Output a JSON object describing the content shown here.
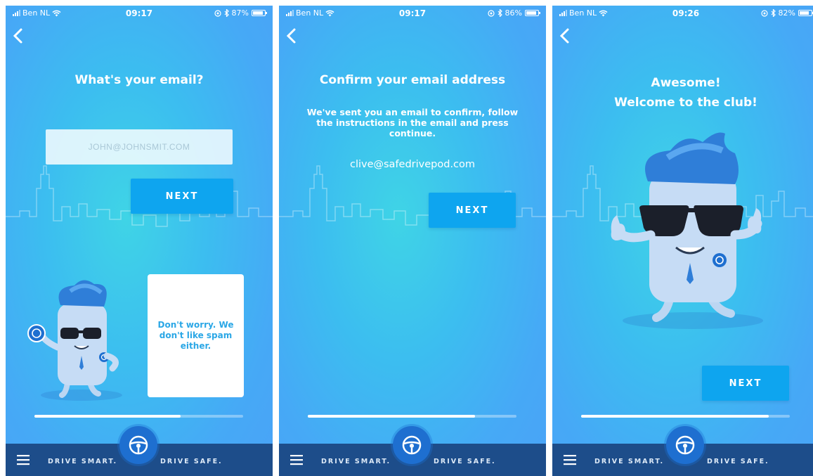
{
  "status_bar": [
    {
      "carrier": "Ben NL",
      "time": "09:17",
      "battery_text": "87%",
      "battery_level": 0.87
    },
    {
      "carrier": "Ben NL",
      "time": "09:17",
      "battery_text": "86%",
      "battery_level": 0.86
    },
    {
      "carrier": "Ben NL",
      "time": "09:26",
      "battery_text": "82%",
      "battery_level": 0.82
    }
  ],
  "screen1": {
    "title": "What's your email?",
    "email_placeholder": "JOHN@JOHNSMIT.COM",
    "next_label": "NEXT",
    "speech": "Don't worry. We don't like spam either.",
    "progress": 0.7
  },
  "screen2": {
    "title": "Confirm your email address",
    "body": "We've sent you an email to confirm, follow the instructions in the email and press continue.",
    "email": "clive@safedrivepod.com",
    "next_label": "NEXT",
    "progress": 0.8
  },
  "screen3": {
    "title_line1": "Awesome!",
    "title_line2": "Welcome to the club!",
    "next_label": "NEXT",
    "progress": 0.9
  },
  "footer": {
    "tagline_left": "DRIVE SMART.",
    "tagline_right": "DRIVE SAFE."
  },
  "icons": [
    "back-chevron-icon",
    "signal-icon",
    "wifi-icon",
    "location-icon",
    "bluetooth-icon",
    "battery-icon",
    "menu-icon",
    "steering-wheel-icon"
  ],
  "colors": {
    "button": "#0ea5ef",
    "footer": "#1d4d8a",
    "badge": "#1e6fd0",
    "speech_text": "#2ba7e6"
  }
}
